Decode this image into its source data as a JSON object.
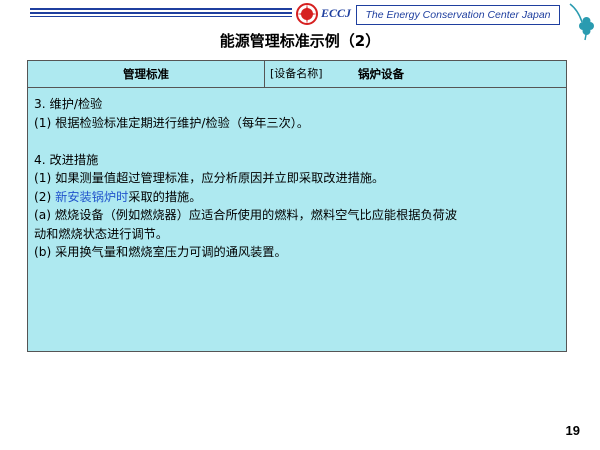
{
  "header": {
    "logo_text": "ECCJ",
    "org_name": "The Energy Conservation Center Japan"
  },
  "title": "能源管理标准示例（2）",
  "table": {
    "col1_header": "管理标准",
    "col2_label": "[设备名称]",
    "col2_value": "锅炉设备"
  },
  "content": {
    "line1": "3. 维护/检验",
    "line2": "(1) 根据检验标准定期进行维护/检验（每年三次）。",
    "line3": "4. 改进措施",
    "line4": "(1) 如果测量值超过管理标准，应分析原因并立即采取改进措施。",
    "line5_prefix": "(2) ",
    "line5_link": "新安装锅炉时",
    "line5_suffix": "采取的措施。",
    "line6a": "(a) 燃烧设备（例如燃烧器）应适合所使用的燃料，燃料空气比应能根据负荷波",
    "line6b": "动和燃烧状态进行调节。",
    "line7": "(b) 采用换气量和燃烧室压力可调的通风装置。"
  },
  "page_number": "19",
  "colors": {
    "accent": "#1f3f9f",
    "table_bg": "#aee9f0",
    "link": "#2255cc",
    "logo_red": "#d62020",
    "clover": "#2a9bb0"
  }
}
